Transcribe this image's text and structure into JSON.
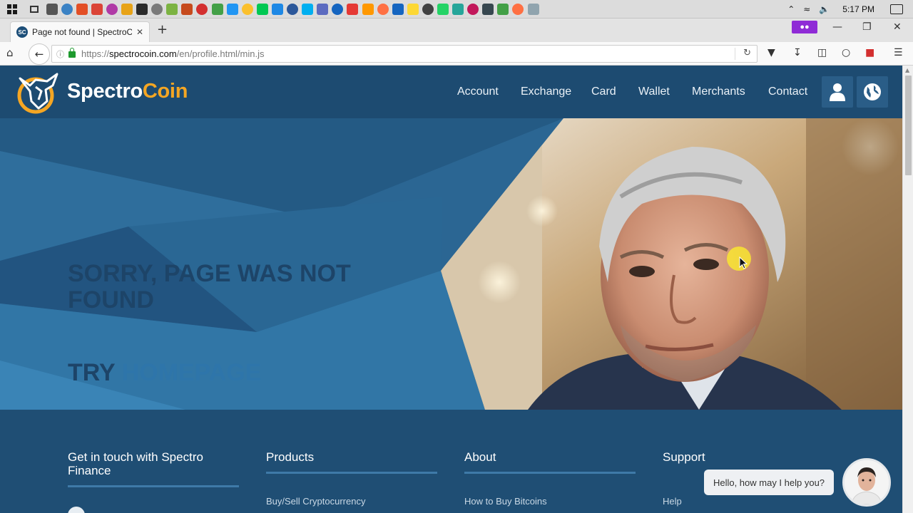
{
  "taskbar": {
    "clock": "5:17 PM",
    "app_icons": [
      "#555555",
      "#3b82c4",
      "#e34f26",
      "#db4437",
      "#b03aa6",
      "#e8a317",
      "#2b2b2b",
      "#7a7a7a",
      "#7cb342",
      "#c64a1d",
      "#d32f2f",
      "#43a047",
      "#2196f3",
      "#fbc02d",
      "#00c853",
      "#1e88e5",
      "#2b579a",
      "#00aff0",
      "#5c6bc0",
      "#1565c0",
      "#e53935",
      "#ff9800",
      "#ff7043",
      "#1565c0",
      "#fdd835",
      "#424242",
      "#25d366",
      "#26a69a",
      "#c2185b",
      "#37474f",
      "#43a047",
      "#ff7043",
      "#90a4ae"
    ],
    "tray_icons": [
      "chevron-up-icon",
      "wifi-icon",
      "volume-icon"
    ]
  },
  "browser": {
    "tab_title": "Page not found | SpectroC...",
    "favicon": "SC",
    "new_tab": "+",
    "url_prefix": "https://",
    "url_domain": "spectrocoin.com",
    "url_path": "/en/profile.html/min.js"
  },
  "header": {
    "brand_1": "Spectro",
    "brand_2": "Coin",
    "nav": [
      "Account",
      "Exchange",
      "Card",
      "Wallet",
      "Merchants",
      "Contact"
    ]
  },
  "hero": {
    "error_title": "SORRY, PAGE WAS NOT FOUND",
    "try_text": "TRY",
    "homepage_link": "HOMEPAGE"
  },
  "footer": {
    "contact_heading": "Get in touch with Spectro Finance",
    "products_heading": "Products",
    "about_heading": "About",
    "support_heading": "Support",
    "products_link": "Buy/Sell Cryptocurrency",
    "about_link": "How to Buy Bitcoins",
    "support_link": "Help"
  },
  "chat": {
    "greeting": "Hello, how may I help you?"
  },
  "colors": {
    "brand_accent": "#f5a623",
    "header_bg": "#1d4b71",
    "hero_bg": "#2b6693"
  }
}
